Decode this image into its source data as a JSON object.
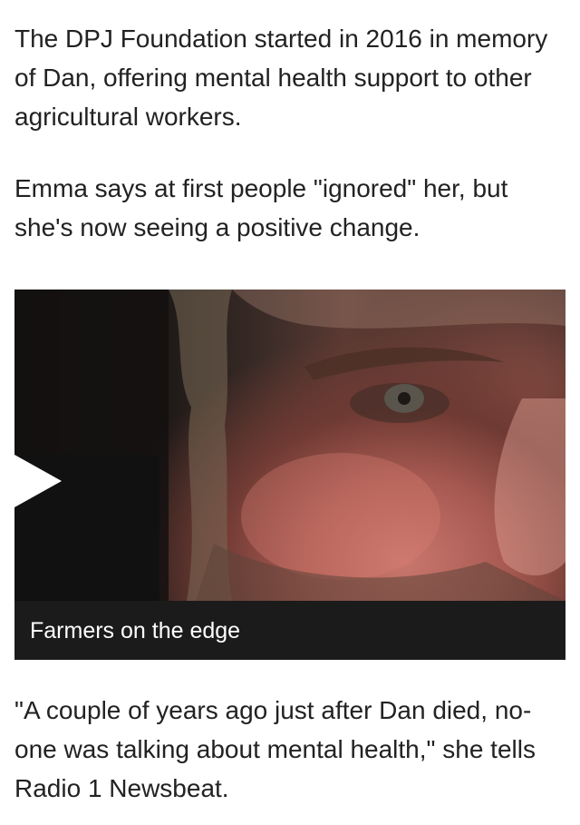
{
  "article": {
    "paragraphs": [
      "The DPJ Foundation started in 2016 in memory of Dan, offering mental health support to other agricultural workers.",
      "Emma says at first people \"ignored\" her, but she's now seeing a positive change.",
      "\"A couple of years ago just after Dan died, no-one was talking about mental health,\" she tells Radio 1 Newsbeat."
    ]
  },
  "video": {
    "caption": "Farmers on the edge",
    "play_icon": "play-icon",
    "caption_bar_color": "#1b1b1b",
    "play_button_color": "#111111"
  }
}
